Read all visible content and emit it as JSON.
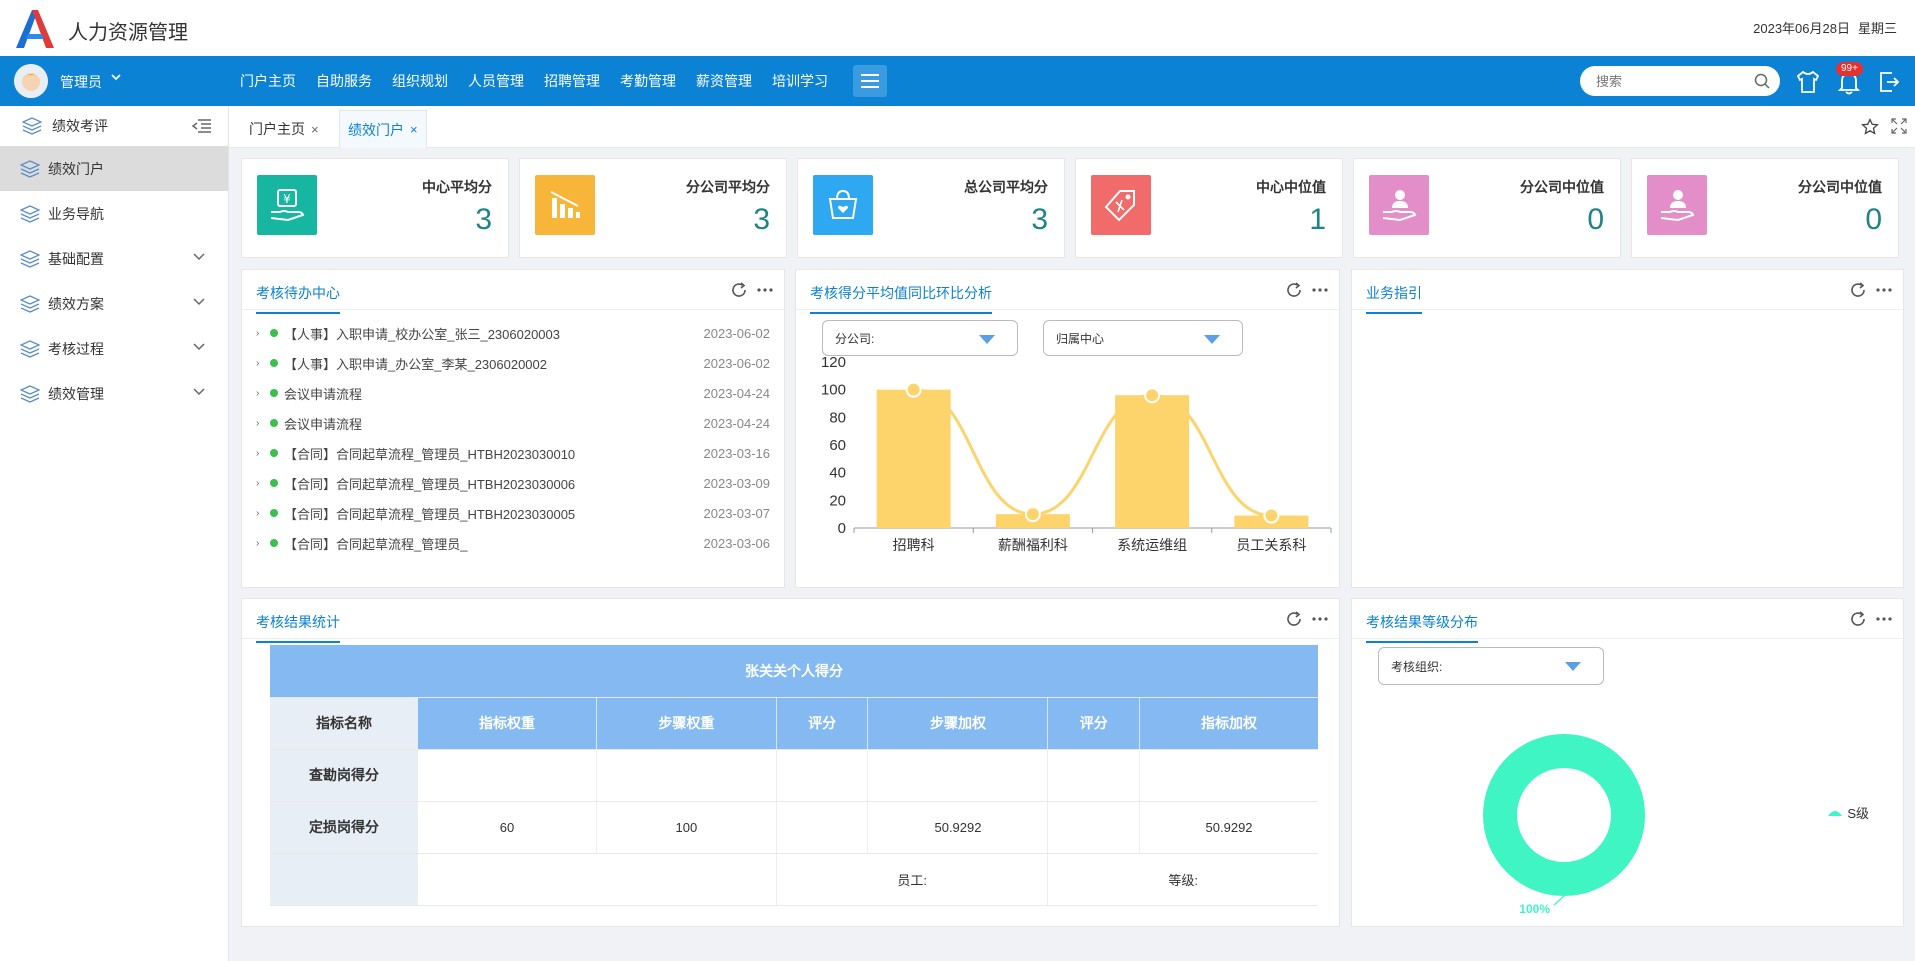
{
  "app": {
    "title": "人力资源管理",
    "date": "2023年06月28日",
    "weekday": "星期三"
  },
  "nav": {
    "user": "管理员",
    "items": [
      "门户主页",
      "自助服务",
      "组织规划",
      "人员管理",
      "招聘管理",
      "考勤管理",
      "薪资管理",
      "培训学习"
    ],
    "search_placeholder": "搜索",
    "badge": "99+"
  },
  "sidebar": {
    "header": "绩效考评",
    "items": [
      {
        "label": "绩效门户",
        "active": true,
        "expandable": false
      },
      {
        "label": "业务导航",
        "active": false,
        "expandable": false
      },
      {
        "label": "基础配置",
        "active": false,
        "expandable": true
      },
      {
        "label": "绩效方案",
        "active": false,
        "expandable": true
      },
      {
        "label": "考核过程",
        "active": false,
        "expandable": true
      },
      {
        "label": "绩效管理",
        "active": false,
        "expandable": true
      }
    ]
  },
  "tabs": [
    {
      "label": "门户主页",
      "close": "×"
    },
    {
      "label": "绩效门户",
      "close": "×"
    }
  ],
  "stats": [
    {
      "label": "中心平均分",
      "value": "3",
      "color": "#16b6a0"
    },
    {
      "label": "分公司平均分",
      "value": "3",
      "color": "#f7b539"
    },
    {
      "label": "总公司平均分",
      "value": "3",
      "color": "#2ea8f0"
    },
    {
      "label": "中心中位值",
      "value": "1",
      "color": "#f26b6b"
    },
    {
      "label": "分公司中位值",
      "value": "0",
      "color": "#e38dc9"
    },
    {
      "label": "分公司中位值",
      "value": "0",
      "color": "#e38dc9"
    }
  ],
  "todo": {
    "title": "考核待办中心",
    "items": [
      {
        "text": "【人事】入职申请_校办公室_张三_2306020003",
        "date": "2023-06-02"
      },
      {
        "text": "【人事】入职申请_办公室_李某_2306020002",
        "date": "2023-06-02"
      },
      {
        "text": "会议申请流程",
        "date": "2023-04-24"
      },
      {
        "text": "会议申请流程",
        "date": "2023-04-24"
      },
      {
        "text": "【合同】合同起草流程_管理员_HTBH2023030010",
        "date": "2023-03-16"
      },
      {
        "text": "【合同】合同起草流程_管理员_HTBH2023030006",
        "date": "2023-03-09"
      },
      {
        "text": "【合同】合同起草流程_管理员_HTBH2023030005",
        "date": "2023-03-07"
      },
      {
        "text": "【合同】合同起草流程_管理员_",
        "date": "2023-03-06"
      }
    ]
  },
  "analysis": {
    "title": "考核得分平均值同比环比分析",
    "filter1": "分公司:",
    "filter2": "归属中心"
  },
  "chart_data": {
    "type": "bar",
    "categories": [
      "招聘科",
      "薪酬福利科",
      "系统运维组",
      "员工关系科"
    ],
    "values": [
      100,
      10,
      96,
      9
    ],
    "line_values": [
      100,
      10,
      96,
      9
    ],
    "ylim": [
      0,
      120
    ],
    "yticks": [
      0,
      20,
      40,
      60,
      80,
      100,
      120
    ],
    "color": "#fdd36b",
    "grid": false
  },
  "guide": {
    "title": "业务指引"
  },
  "results": {
    "title": "考核结果统计",
    "caption": "张关关个人得分",
    "headers": [
      "指标名称",
      "指标权重",
      "步骤权重",
      "评分",
      "步骤加权",
      "评分",
      "指标加权"
    ],
    "rows": [
      {
        "name": "查勘岗得分",
        "cells": [
          "",
          "",
          "",
          "",
          "",
          ""
        ]
      },
      {
        "name": "定损岗得分",
        "cells": [
          "60",
          "100",
          "",
          "50.9292",
          "",
          "50.9292"
        ]
      }
    ],
    "employee_label": "员工:",
    "grade_label": "等级:"
  },
  "grade": {
    "title": "考核结果等级分布",
    "filter": "考核组织:",
    "legend": "S级",
    "percent": "100%",
    "color": "#3ff5c4"
  }
}
